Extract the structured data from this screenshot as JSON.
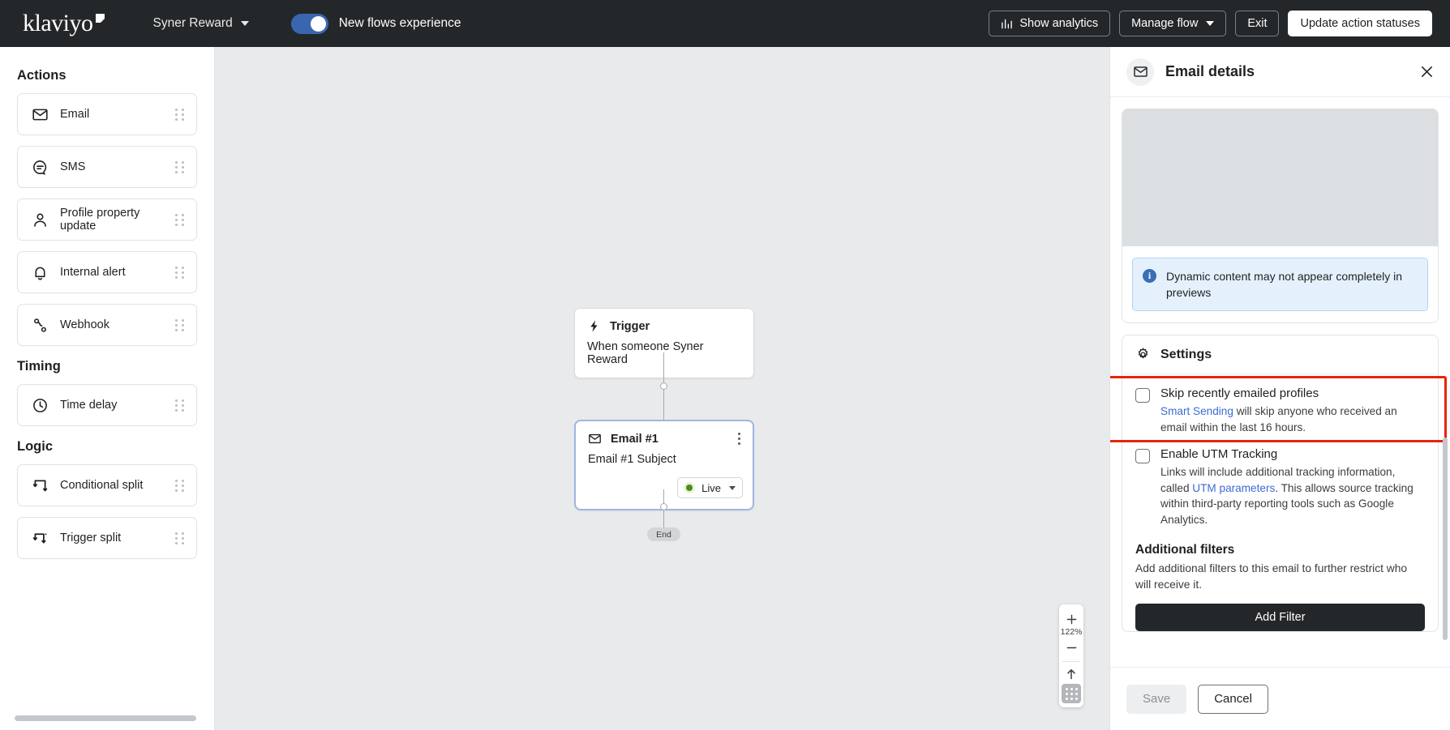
{
  "topbar": {
    "logo_text": "klaviyo",
    "flow_name": "Syner Reward",
    "toggle_label": "New flows experience",
    "toggle_on": true,
    "buttons": {
      "show_analytics": "Show analytics",
      "manage_flow": "Manage flow",
      "exit": "Exit",
      "update_action_statuses": "Update action statuses"
    }
  },
  "sidebar": {
    "sections": [
      {
        "title": "Actions",
        "items": [
          {
            "label": "Email",
            "icon": "envelope-icon"
          },
          {
            "label": "SMS",
            "icon": "sms-bubble-icon"
          },
          {
            "label": "Profile property update",
            "icon": "person-icon"
          },
          {
            "label": "Internal alert",
            "icon": "bell-icon"
          },
          {
            "label": "Webhook",
            "icon": "webhook-icon"
          }
        ]
      },
      {
        "title": "Timing",
        "items": [
          {
            "label": "Time delay",
            "icon": "clock-icon"
          }
        ]
      },
      {
        "title": "Logic",
        "items": [
          {
            "label": "Conditional split",
            "icon": "split-icon"
          },
          {
            "label": "Trigger split",
            "icon": "trigger-split-icon"
          }
        ]
      }
    ]
  },
  "canvas": {
    "trigger_node": {
      "title": "Trigger",
      "subtitle": "When someone Syner Reward",
      "icon": "lightning-bolt-icon"
    },
    "email_node": {
      "title": "Email #1",
      "subtitle": "Email #1 Subject",
      "icon": "envelope-icon",
      "status_label": "Live"
    },
    "end_label": "End",
    "zoom_controls": {
      "zoom_in": "+",
      "zoom_level": "122%",
      "zoom_out": "−",
      "fit_icon": "arrow-up-icon",
      "grid_icon": "grid-icon"
    }
  },
  "panel": {
    "title": "Email details",
    "icon": "envelope-icon",
    "close_icon": "close-icon",
    "info_banner": {
      "icon": "info-icon",
      "text": "Dynamic content may not appear completely in previews"
    },
    "settings": {
      "heading": "Settings",
      "icon": "gear-icon",
      "options": [
        {
          "title": "Skip recently emailed profiles",
          "link_text": "Smart Sending",
          "desc_after_link": " will skip anyone who received an email within the last 16 hours.",
          "checked": false,
          "highlighted": true
        },
        {
          "title": "Enable UTM Tracking",
          "desc_before_link": "Links will include additional tracking information, called ",
          "link_text": "UTM parameters",
          "desc_after_link": ". This allows source tracking within third-party reporting tools such as Google Analytics.",
          "checked": false,
          "highlighted": false
        }
      ],
      "additional_filters": {
        "heading": "Additional filters",
        "desc": "Add additional filters to this email to further restrict who will receive it.",
        "button_label": "Add Filter"
      }
    },
    "footer": {
      "save_label": "Save",
      "cancel_label": "Cancel"
    }
  },
  "colors": {
    "topbar_bg": "#24272a",
    "canvas_bg": "#e9eaec",
    "accent_blue": "#3a66b0",
    "link_blue": "#3b6bd4",
    "highlight_red": "#e8230b",
    "live_green": "#4e8c1f"
  }
}
